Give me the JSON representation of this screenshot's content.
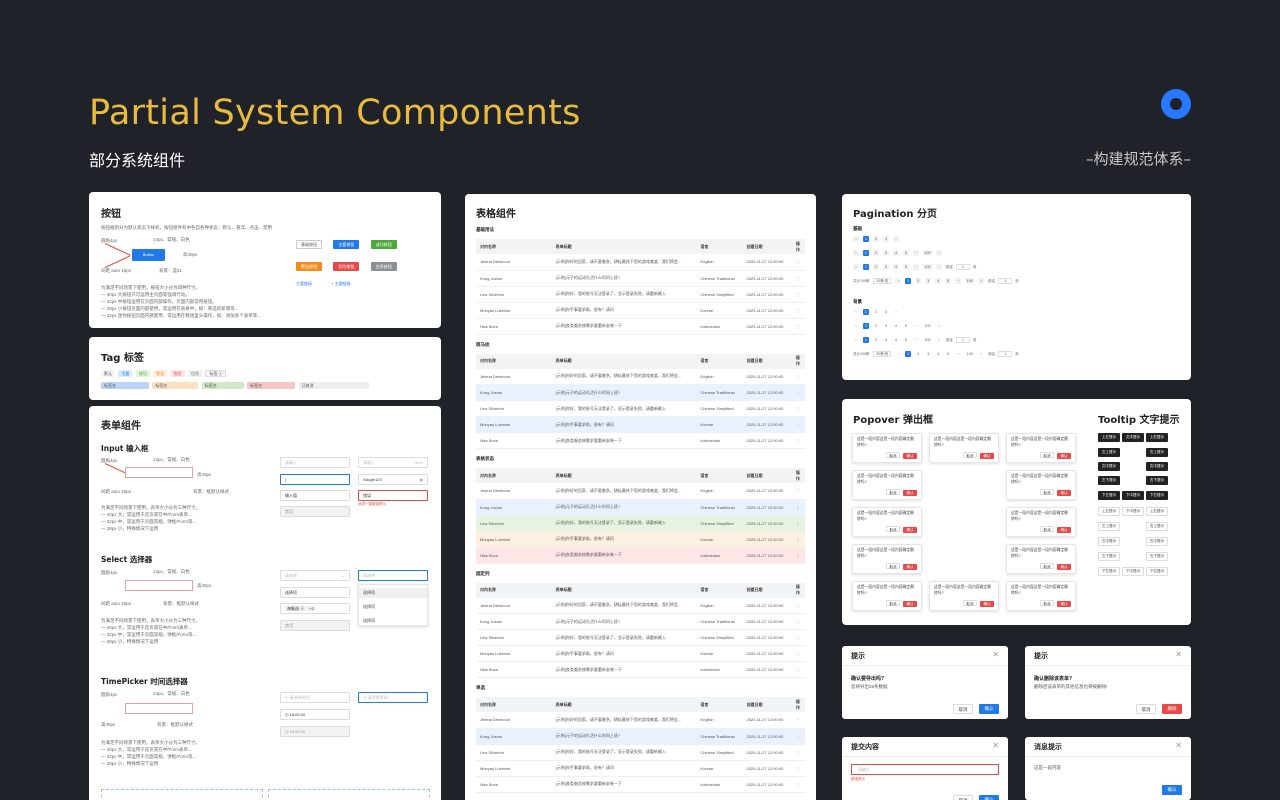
{
  "header": {
    "title": "Partial System Components",
    "subtitle": "部分系统组件",
    "right_caption": "–构建规范体系–"
  },
  "buttons_card": {
    "title": "按钮",
    "desc": "按钮规则分为默认状态下样式，按钮组件有中各自各种状态：默认、悬浮、点击、禁用",
    "spec_left": "圆角4px",
    "spec_top": "14px、常规、白色",
    "spec_right": "高40px",
    "spec_bottom_left": "间距 auto 16px",
    "spec_bottom": "背景：蓝51",
    "demo_label": "Button",
    "notes": [
      "为满足不同场景下使用，按钮大小分为四种尺寸。",
      "— 40px 大按钮只可运用主页面等强调行动。",
      "— 32px 中按钮运用在页面内部操作，页面内部常用按钮。",
      "— 28px 小按钮页面内部使用，常运用在表格中，如：筛选的新增等...",
      "— 22px 迷你按钮页面内部使用，常运用在数组里头操作，如：添加多个表单等..."
    ],
    "b1": "基础按钮",
    "b2": "主要按钮",
    "b3": "成功按钮",
    "b4": "警告按钮",
    "b5": "危险按钮",
    "b6": "信息按钮",
    "link1": "主要链接",
    "link2": "+ 主要链接"
  },
  "tag_card": {
    "title": "Tag 标签",
    "tags": [
      "默认",
      "主要",
      "成功",
      "警告",
      "危险",
      "信息",
      "标签 ⓧ"
    ],
    "tags2": [
      "标签名",
      "标签名",
      "标签名",
      "标签名",
      "已取消"
    ]
  },
  "form_card": {
    "title": "表单组件",
    "input_title": "Input 输入框",
    "select_title": "Select 选择器",
    "time_title": "TimePicker 时间选择器",
    "spec_left": "圆角4px",
    "spec_top": "14px、常规、白色",
    "spec_right": "高40px",
    "spec_bottom_left": "间距 auto 16px",
    "spec_bottom": "背景：框默认样式",
    "input_notes": [
      "为满足不同场景下使用，表单大小分为三种尺寸。",
      "— 40px 大，常运用于首页或在中/Form表单...",
      "— 32px 中，常运用于页面常规，弹框/Form等...",
      "— 28px 小，特殊情况下运用"
    ],
    "ph1": "请输入",
    "ph2": "请输入",
    "count": "8/30",
    "v_input": "输入值",
    "v_pwd": "Xiaojie123",
    "v_err": "错误",
    "err_msg": "此项一直错误提示",
    "v_disabled": "禁用",
    "sel_ph": "请选择",
    "sel_ph2": "请选择",
    "sel_v1": "选择项",
    "sel_tag": "海象选 ⓧ",
    "sel_tag_more": "+2",
    "sel_disabled": "禁用",
    "opt1": "选择项",
    "opt2": "选择项",
    "opt3": "选择项",
    "tp_ph1": "请选择时间",
    "tp_ph2": "请选择时间",
    "tp_v1": "18:00:00",
    "tp_v2": "18:00:00"
  },
  "table_card": {
    "title": "表格组件",
    "sections": [
      "基础用法",
      "斑马纹",
      "表格状态",
      "固定列",
      "单选"
    ],
    "headers": [
      "对内名称",
      "表单标题",
      "语言",
      "创建日期",
      "操作"
    ],
    "rows": [
      [
        "Jelena Demkova",
        "[示例]你好的回家，请不要着急，耕耘最终下您的游戏难度，我们将会...",
        "English",
        "2020-11-27 12:00:00",
        "⋮"
      ],
      [
        "Kung Juxian",
        "[示例]元子的运动孔活什么时间上班?",
        "Chinese Traditional",
        "2020-11-27 12:00:00",
        "⋮"
      ],
      [
        "Lew Silverton",
        "[示例]你好，我的账号无法登录了，显示登录失败，请重新输入",
        "Chinese Simplified",
        "2020-11-27 12:00:00",
        "⋮"
      ],
      [
        "Monyas Lukmine",
        "[示例]你手事要求助，很有？请问",
        "Korean",
        "2020-11-27 12:00:00",
        "⋮"
      ],
      [
        "Nisk Bove",
        "[示例]各类服务按需求要重新安装一下",
        "Indonesian",
        "2020-11-27 12:00:00",
        "⋮"
      ]
    ]
  },
  "pagination_card": {
    "title": "Pagination 分页",
    "basic": "基础",
    "bg": "背景",
    "total": "共计100条",
    "per_page": "20条/页",
    "jump": "前往",
    "page_unit": "页",
    "pages": [
      "1",
      "2",
      "3",
      "4",
      "5"
    ],
    "ellipsis": "···",
    "last": "100",
    "jump_val": "1"
  },
  "popover_card": {
    "title": "Popover 弹出框",
    "text": "这是一段内容这是一段内容确定删除吗?",
    "cancel": "取消",
    "confirm": "确认"
  },
  "tooltip_card": {
    "title": "Tooltip 文字提示",
    "labels": [
      "上左提示",
      "文字提示",
      "上右提示",
      "左上提示",
      "右上提示",
      "左中提示",
      "右中提示",
      "左下提示",
      "右下提示",
      "下左提示",
      "下中提示",
      "下右提示"
    ]
  },
  "dialogs": [
    {
      "title": "提示",
      "heading": "确认要导出吗?",
      "body": "您将导出25条数据",
      "cancel": "取消",
      "ok": "确认",
      "ok_color": "#1f7ae8"
    },
    {
      "title": "提示",
      "heading": "确认删除该表单?",
      "body": "删除后该表单的其他信息也将被删除!",
      "cancel": "取消",
      "ok": "删除",
      "ok_color": "#e84848"
    },
    {
      "title": "提交内容",
      "placeholder": "请输入",
      "err": "错误提示",
      "cancel": "取消",
      "ok": "确认",
      "ok_color": "#1f7ae8"
    },
    {
      "title": "消息提示",
      "body": "这是一段内容",
      "ok": "确认",
      "ok_color": "#1f7ae8"
    }
  ]
}
